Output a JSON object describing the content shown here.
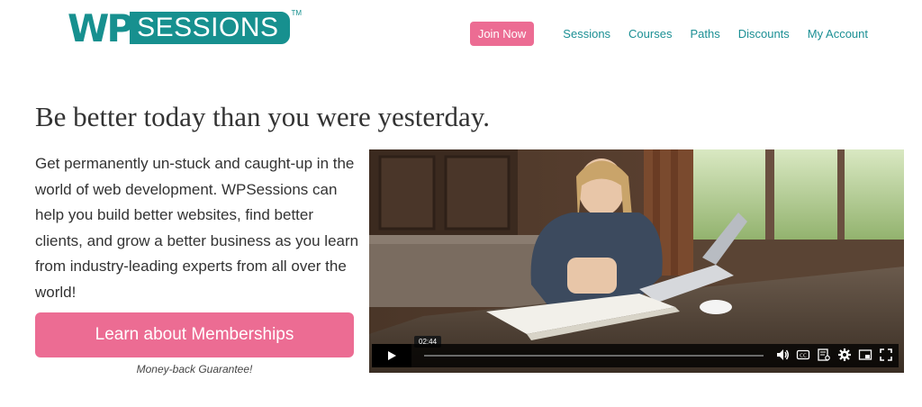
{
  "header": {
    "logo": {
      "wp": "WP",
      "sessions": "SESSIONS",
      "tm": "TM"
    },
    "nav": {
      "join_label": "Join Now",
      "links": [
        "Sessions",
        "Courses",
        "Paths",
        "Discounts",
        "My Account"
      ]
    }
  },
  "hero": {
    "headline": "Be better today than you were yesterday.",
    "intro": "Get permanently un-stuck and caught-up in the world of web development. WPSessions can help you build better websites, find better clients, and grow a better business as you learn from industry-leading experts from all over the world!",
    "cta_label": "Learn about Memberships",
    "guarantee": "Money-back Guarantee!"
  },
  "video": {
    "time_tooltip": "02:44",
    "icons": [
      "play-icon",
      "volume-icon",
      "captions-icon",
      "transcript-icon",
      "settings-icon",
      "pip-icon",
      "fullscreen-icon"
    ]
  },
  "colors": {
    "brand_teal": "#17908f",
    "link_teal": "#1b8f94",
    "accent_pink": "#ec6c93"
  }
}
